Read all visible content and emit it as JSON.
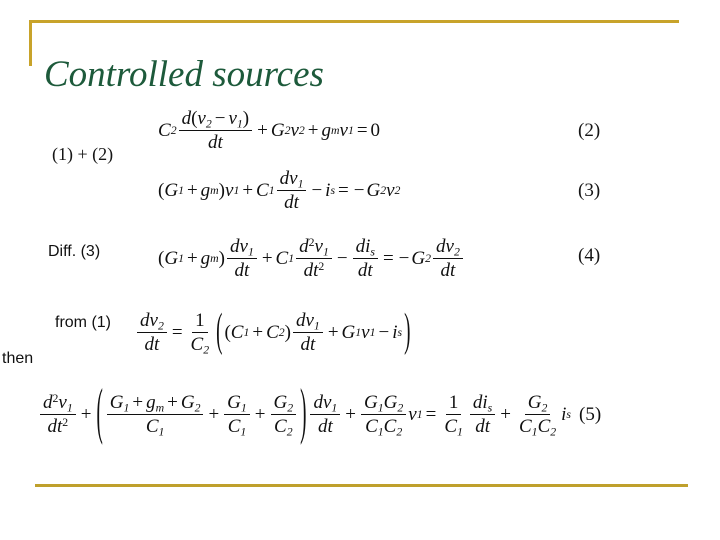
{
  "slide": {
    "title": "Controlled sources",
    "accent_gold": "#c8a32a",
    "title_green": "#1d5a3b",
    "background": "#ffffff"
  },
  "annotations": {
    "sum_label": "(1) + (2)",
    "diff_label": "Diff. (3)",
    "from_label": "from (1)",
    "then_label": "then"
  },
  "equation_numbers": {
    "two": "(2)",
    "three": "(3)",
    "four": "(4)",
    "five": "(5)"
  },
  "equations": {
    "eq2": {
      "number": "(2)",
      "plain": "C2 d(v2 - v1)/dt + G2 v2 + gm v1 = 0",
      "tokens": {
        "C": "C",
        "C_sub": "2",
        "num_d": "d",
        "num_open": "(",
        "num_v2": "v",
        "num_v2_sub": "2",
        "num_minus": "−",
        "num_v1": "v",
        "num_v1_sub": "1",
        "num_close": ")",
        "den": "dt",
        "plus1": "+",
        "G": "G",
        "G_sub": "2",
        "v": "v",
        "v_sub": "2",
        "plus2": "+",
        "g": "g",
        "g_sub": "m",
        "v1": "v",
        "v1_sub": "1",
        "equals": "=",
        "zero": "0"
      }
    },
    "eq3": {
      "number": "(3)",
      "plain": "(G1 + gm) v1 + C1 dv1/dt - is = -G2 v2",
      "tokens": {
        "open": "(",
        "G": "G",
        "G_sub": "1",
        "plus": "+",
        "g": "g",
        "g_sub": "m",
        "close": ")",
        "v": "v",
        "v_sub": "1",
        "plus2": "+",
        "C": "C",
        "C_sub": "1",
        "num": "dv",
        "num_sub": "1",
        "den": "dt",
        "minus": "−",
        "i": "i",
        "i_sub": "s",
        "equals": "=",
        "neg": "−",
        "G2": "G",
        "G2_sub": "2",
        "v2": "v",
        "v2_sub": "2"
      }
    },
    "eq4": {
      "number": "(4)",
      "plain": "(G1 + gm) dv1/dt + C1 d2v1/dt2 - dis/dt = -G2 dv2/dt",
      "tokens": {
        "open": "(",
        "G": "G",
        "G_sub": "1",
        "plus": "+",
        "g": "g",
        "g_sub": "m",
        "close": ")",
        "f1_num": "dv",
        "f1_num_sub": "1",
        "f1_den": "dt",
        "plus2": "+",
        "C": "C",
        "C_sub": "1",
        "f2_num_d": "d",
        "f2_num_sup": "2",
        "f2_num_v": "v",
        "f2_num_v_sub": "1",
        "f2_den_dt": "dt",
        "f2_den_sup": "2",
        "minus": "−",
        "f3_num": "di",
        "f3_num_sub": "s",
        "f3_den": "dt",
        "equals": "=",
        "neg": "−",
        "G2": "G",
        "G2_sub": "2",
        "f4_num": "dv",
        "f4_num_sub": "2",
        "f4_den": "dt"
      }
    },
    "eq_from1": {
      "number": "",
      "plain": "dv2/dt = (1/C2) ( (C1 + C2) dv1/dt + G1 v1 - is )",
      "tokens": {
        "lhs_num": "dv",
        "lhs_num_sub": "2",
        "lhs_den": "dt",
        "equals": "=",
        "one": "1",
        "C2d": "C",
        "C2d_sub": "2",
        "lparen": "(",
        "open": "(",
        "C1": "C",
        "C1_sub": "1",
        "plus": "+",
        "C2": "C",
        "C2_sub": "2",
        "close": ")",
        "f_num": "dv",
        "f_num_sub": "1",
        "f_den": "dt",
        "plus2": "+",
        "G1": "G",
        "G1_sub": "1",
        "v1": "v",
        "v1_sub": "1",
        "minus": "−",
        "i": "i",
        "i_sub": "s",
        "rparen": ")"
      }
    },
    "eq5": {
      "number": "(5)",
      "plain": "d2v1/dt2 + ((G1 + gm + G2)/C1 + G1/C1 + G2/C2) dv1/dt + G1G2/(C1C2) v1 = (1/C1) dis/dt + G2/(C1C2) is",
      "tokens": {
        "t1_num_d": "d",
        "t1_num_sup": "2",
        "t1_num_v": "v",
        "t1_num_v_sub": "1",
        "t1_den_dt": "dt",
        "t1_den_sup": "2",
        "plus1": "+",
        "lparen": "(",
        "b1_num_G1": "G",
        "b1_num_G1_sub": "1",
        "b1_num_plus1": "+",
        "b1_num_g": "g",
        "b1_num_g_sub": "m",
        "b1_num_plus2": "+",
        "b1_num_G2": "G",
        "b1_num_G2_sub": "2",
        "b1_den": "C",
        "b1_den_sub": "1",
        "plus2": "+",
        "b2_num": "G",
        "b2_num_sub": "1",
        "b2_den": "C",
        "b2_den_sub": "1",
        "plus3": "+",
        "b3_num": "G",
        "b3_num_sub": "2",
        "b3_den": "C",
        "b3_den_sub": "2",
        "rparen": ")",
        "t2_num": "dv",
        "t2_num_sub": "1",
        "t2_den": "dt",
        "plus4": "+",
        "t3_num_G1": "G",
        "t3_num_G1_sub": "1",
        "t3_num_G2": "G",
        "t3_num_G2_sub": "2",
        "t3_den_C1": "C",
        "t3_den_C1_sub": "1",
        "t3_den_C2": "C",
        "t3_den_C2_sub": "2",
        "t3_v": "v",
        "t3_v_sub": "1",
        "equals": "=",
        "r1_num": "1",
        "r1_den": "C",
        "r1_den_sub": "1",
        "r2_num": "di",
        "r2_num_sub": "s",
        "r2_den": "dt",
        "plus5": "+",
        "r3_num": "G",
        "r3_num_sub": "2",
        "r3_den_C1": "C",
        "r3_den_C1_sub": "1",
        "r3_den_C2": "C",
        "r3_den_C2_sub": "2",
        "r3_i": "i",
        "r3_i_sub": "s",
        "tail_num": "(5)"
      }
    }
  }
}
